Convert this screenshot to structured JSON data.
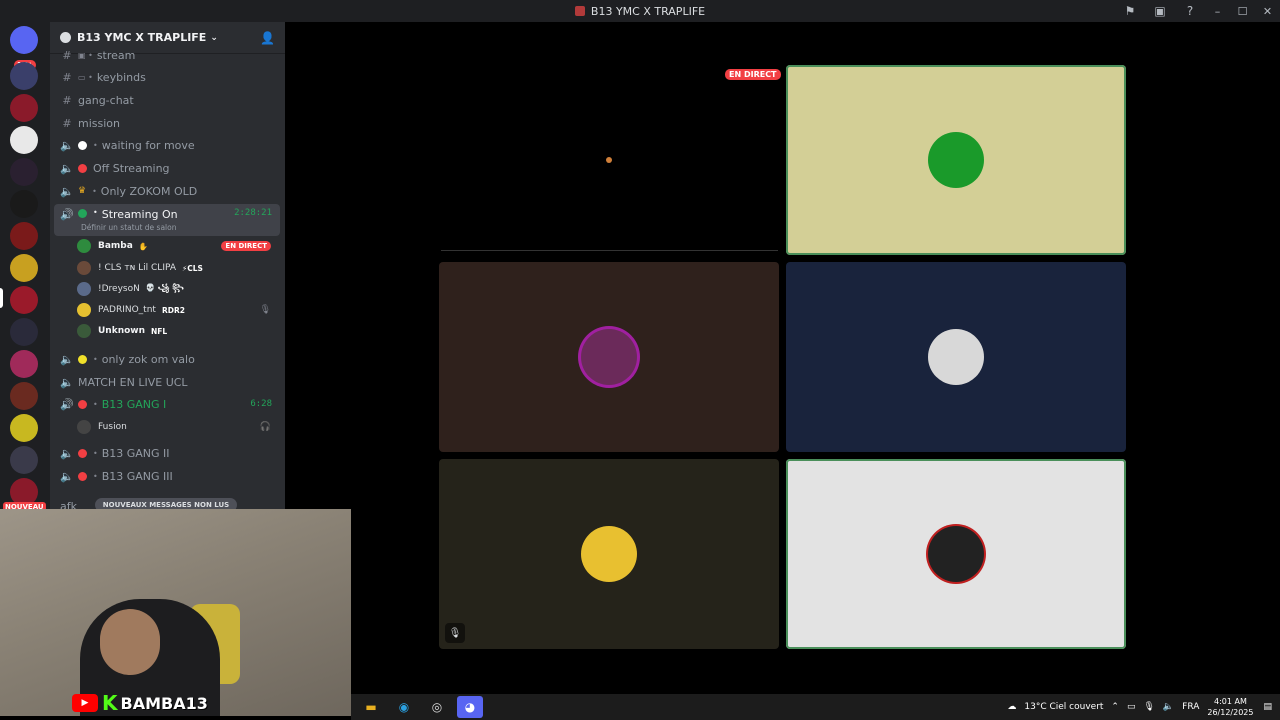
{
  "window": {
    "title": "B13 YMC X TRAPLIFE"
  },
  "server": {
    "name": "B13 YMC X TRAPLIFE",
    "unread_badge": "1K+"
  },
  "channels": [
    {
      "type": "text",
      "name": "stream",
      "sub": ""
    },
    {
      "type": "text",
      "name": "keybinds",
      "sub": ""
    },
    {
      "type": "text",
      "name": "gang-chat",
      "sub": ""
    },
    {
      "type": "text",
      "name": "mission",
      "sub": ""
    },
    {
      "type": "voice",
      "name": "waiting for move",
      "status_color": "#ffffff"
    },
    {
      "type": "voice",
      "name": "Off Streaming",
      "status_color": "#f23f43"
    },
    {
      "type": "voice",
      "name": "Only ZOKOM OLD",
      "status_color": "crown"
    },
    {
      "type": "voice",
      "name": "Streaming On",
      "status_color": "#23a55a",
      "timer": "2:28:21",
      "status_line": "Définir un statut de salon"
    },
    {
      "type": "voice",
      "name": "only zok om valo",
      "status_color": "#f0e02a"
    },
    {
      "type": "voice",
      "name": "MATCH EN LIVE UCL",
      "status_color": ""
    },
    {
      "type": "voice",
      "name": "B13 GANG I",
      "status_color": "#f23f43",
      "timer": "6:28"
    },
    {
      "type": "voice",
      "name": "B13 GANG II",
      "status_color": "#f23f43"
    },
    {
      "type": "voice",
      "name": "B13 GANG III",
      "status_color": "#f23f43"
    },
    {
      "type": "voice",
      "name": "afk",
      "status_color": ""
    }
  ],
  "streaming_users": [
    {
      "name": "Bamba",
      "tag": "",
      "live": "EN DIRECT",
      "avatar_color": "#2e8b3e"
    },
    {
      "name": "! CLS ᴛɴ Lil CLIPA",
      "tag": "⚡CLS",
      "avatar_color": "#6a4a3a"
    },
    {
      "name": "!DreysoN",
      "tag": "💀 ꧁ ꧂",
      "avatar_color": "#5a6a8a"
    },
    {
      "name": "PADRINO_tnt",
      "tag": "RDR2",
      "avatar_color": "#e5c030"
    },
    {
      "name": "Unknown",
      "tag": "NFL",
      "avatar_color": "#3a5a3a"
    }
  ],
  "gang1_users": [
    {
      "name": "Fusion",
      "avatar_color": "#444"
    }
  ],
  "new_messages_label": "NOUVEAUX MESSAGES NON LUS",
  "nouveau_badge": "NOUVEAU",
  "stage": {
    "live_label": "EN DIRECT",
    "tiles": [
      {
        "id": "bamba",
        "bg": "#d3cf96",
        "avatar_color": "#1a9a2a",
        "speaking": true
      },
      {
        "id": "cls",
        "bg": "#2f211c",
        "avatar_color": "#6b2a5a",
        "speaking": false
      },
      {
        "id": "dreyson",
        "bg": "#19233c",
        "avatar_color": "#d8d8d8",
        "speaking": false
      },
      {
        "id": "padrino",
        "bg": "#25231a",
        "avatar_color": "#e8c030",
        "speaking": false
      },
      {
        "id": "unknown",
        "bg": "#e3e3e3",
        "avatar_color": "#222222",
        "speaking": true
      }
    ]
  },
  "overlay": {
    "channel_name": "BAMBA13"
  },
  "taskbar": {
    "weather": "13°C  Ciel couvert",
    "lang": "FRA",
    "time": "4:01 AM",
    "date": "26/12/2025"
  }
}
